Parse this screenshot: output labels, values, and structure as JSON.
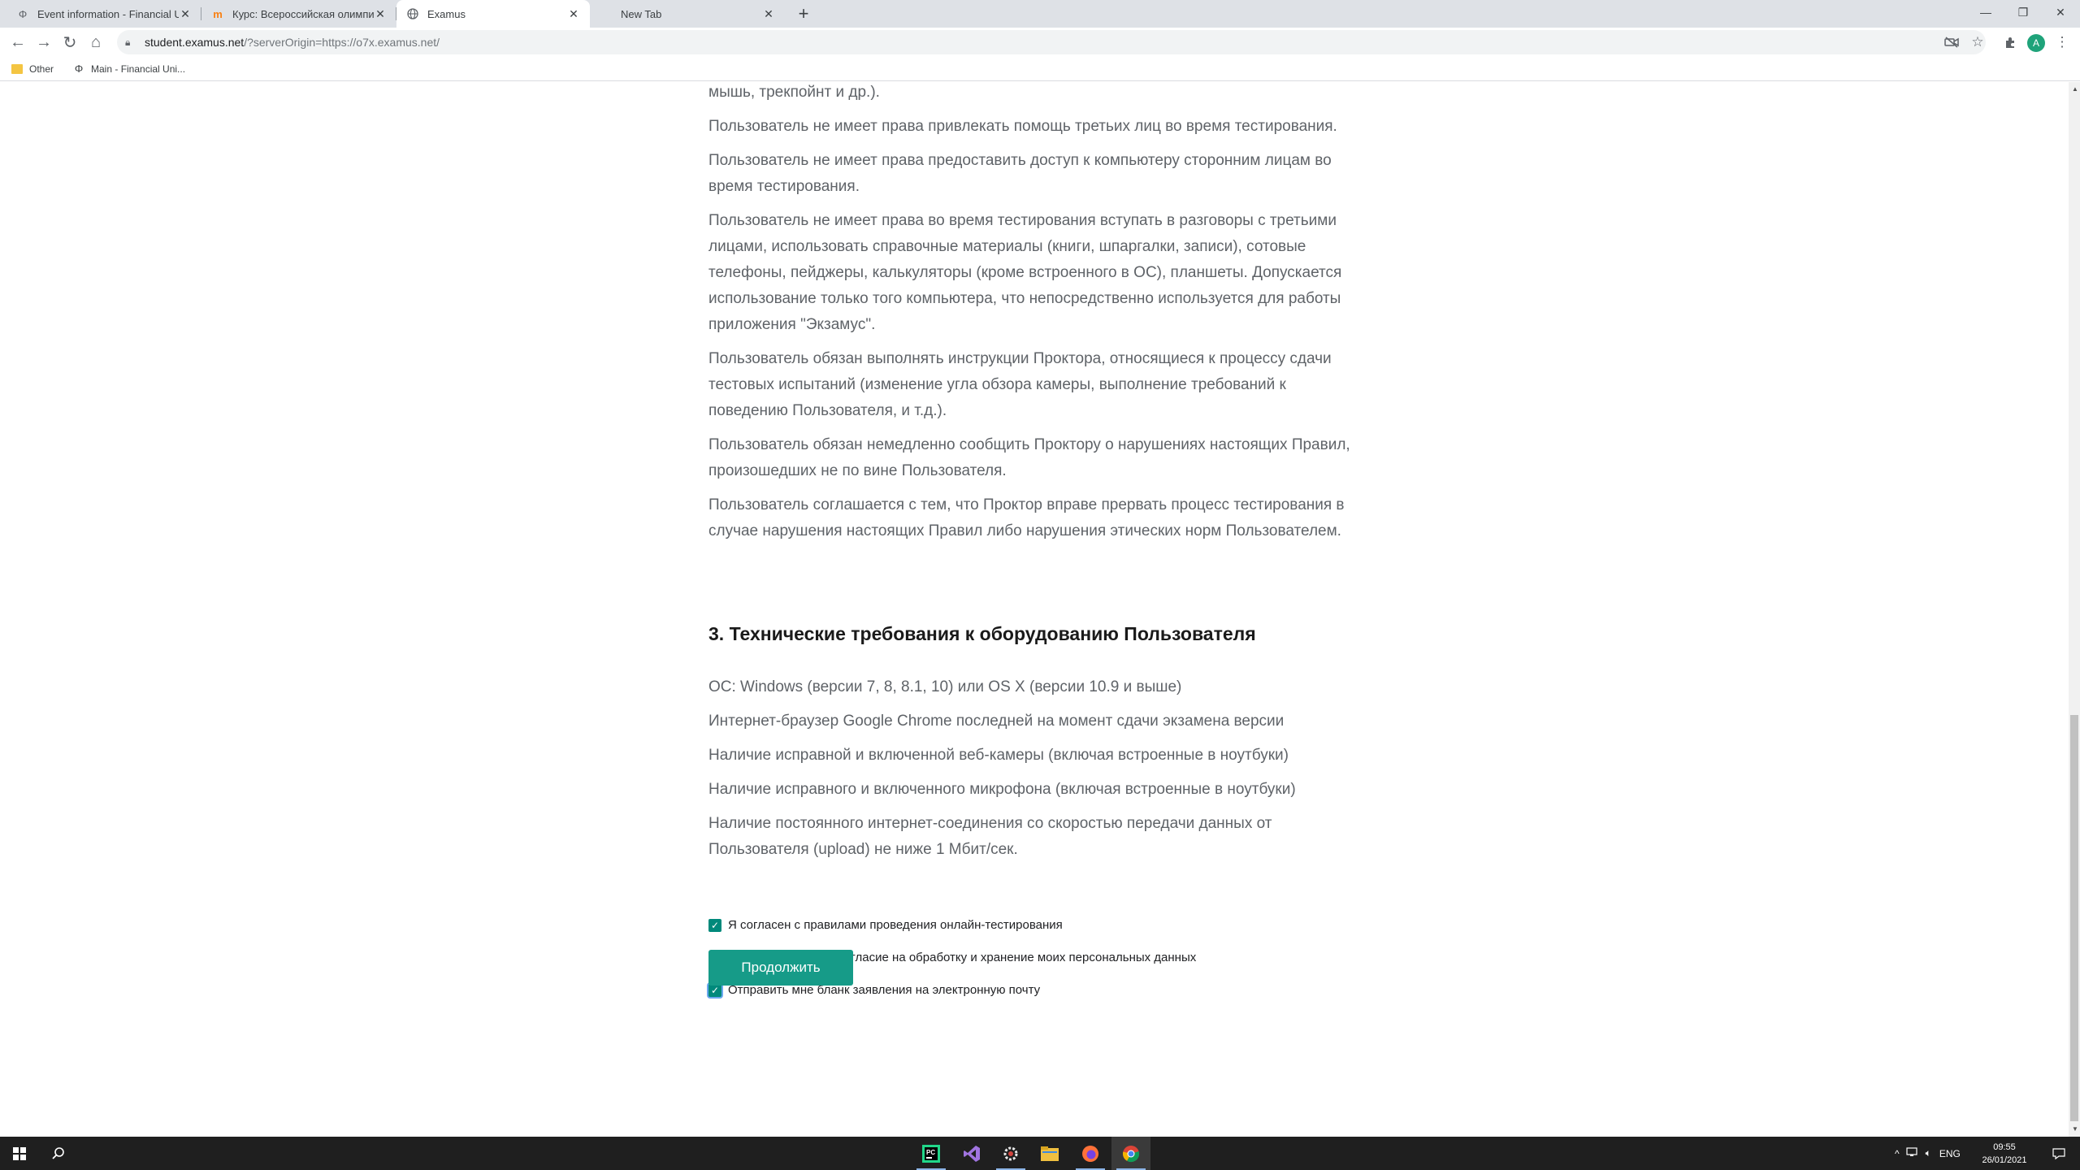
{
  "browser": {
    "tabs": [
      {
        "title": "Event information - Financial Uni",
        "favicon": "phi-icon"
      },
      {
        "title": "Курс: Всероссийская олимпиада",
        "favicon": "moodle-icon"
      },
      {
        "title": "Examus",
        "favicon": "globe-icon",
        "active": true
      },
      {
        "title": "New Tab",
        "favicon": ""
      }
    ],
    "address": {
      "host": "student.examus.net",
      "path": "/?serverOrigin=https://o7x.examus.net/"
    },
    "bookmarks": [
      {
        "label": "Other",
        "icon": "folder-icon"
      },
      {
        "label": "Main - Financial Uni...",
        "icon": "phi-icon"
      }
    ],
    "profile_initial": "A"
  },
  "page": {
    "paragraphs": [
      "мышь, трекпойнт и др.).",
      "Пользователь не имеет права привлекать помощь третьих лиц во время тестирования.",
      "Пользователь не имеет права предоставить доступ к компьютеру сторонним лицам во время тестирования.",
      "Пользователь не имеет права во время тестирования вступать в разговоры с третьими лицами, использовать справочные материалы (книги, шпаргалки, записи), сотовые телефоны, пейджеры, калькуляторы (кроме встроенного в ОС), планшеты. Допускается использование только того компьютера, что непосредственно используется для работы приложения \"Экзамус\".",
      "Пользователь обязан выполнять инструкции Проктора, относящиеся к процессу сдачи тестовых испытаний (изменение угла обзора камеры, выполнение требований к поведению Пользователя, и т.д.).",
      "Пользователь обязан немедленно сообщить Проктору о нарушениях настоящих Правил, произошедших не по вине Пользователя.",
      "Пользователь соглашается с тем, что Проктор вправе прервать процесс тестирования в случае нарушения настоящих Правил либо нарушения этических норм Пользователем."
    ],
    "section_title": "3. Технические требования к оборудованию Пользователя",
    "requirements": [
      "ОС: Windows (версии 7, 8, 8.1, 10) или OS X (версии 10.9 и выше)",
      "Интернет-браузер Google Chrome последней на момент сдачи экзамена версии",
      "Наличие исправной и включенной веб-камеры (включая встроенные в ноутбуки)",
      "Наличие исправного и включенного микрофона (включая встроенные в ноутбуки)",
      "Наличие постоянного интернет-соединения со скоростью передачи данных от Пользователя (upload) не ниже 1 Мбит/сек."
    ],
    "checkboxes": [
      {
        "label": "Я согласен с правилами проведения онлайн-тестирования",
        "checked": true
      },
      {
        "label": "Я даю письменное согласие на обработку и хранение моих персональных данных",
        "checked": true
      },
      {
        "label": "Отправить мне бланк заявления на электронную почту",
        "checked": true
      }
    ],
    "continue_label": "Продолжить",
    "accent_color": "#169b88"
  },
  "taskbar": {
    "language": "ENG",
    "time": "09:55",
    "date": "26/01/2021"
  }
}
